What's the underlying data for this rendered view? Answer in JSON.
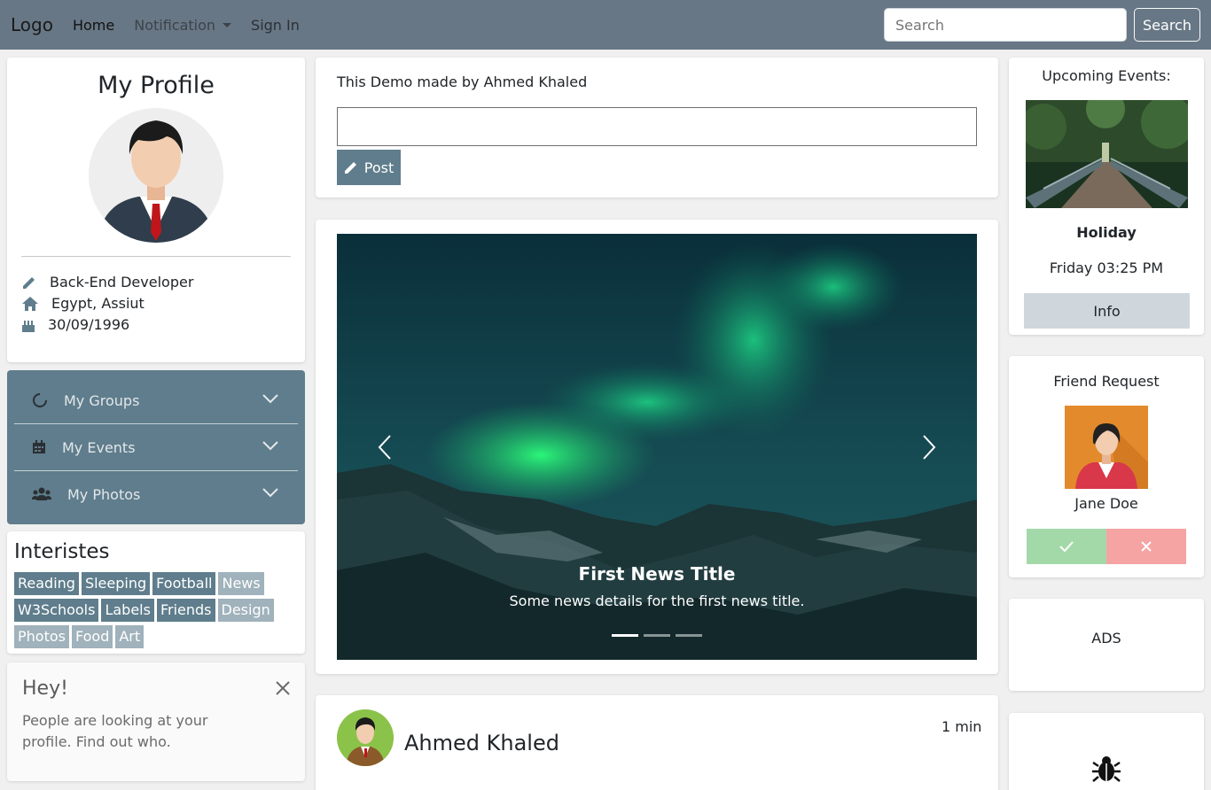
{
  "navbar": {
    "brand": "Logo",
    "links": [
      "Home",
      "Notification",
      "Sign In"
    ],
    "search_placeholder": "Search",
    "search_button": "Search"
  },
  "profile": {
    "title": "My Profile",
    "details": [
      {
        "icon": "pencil-icon",
        "text": "Back-End Developer"
      },
      {
        "icon": "home-icon",
        "text": "Egypt, Assiut"
      },
      {
        "icon": "birthday-cake-icon",
        "text": "30/09/1996"
      }
    ]
  },
  "accordion": {
    "items": [
      {
        "icon": "circle-notch-icon",
        "label": "My Groups"
      },
      {
        "icon": "calendar-icon",
        "label": "My Events"
      },
      {
        "icon": "users-icon",
        "label": "My Photos"
      }
    ]
  },
  "interests": {
    "title": "Interistes",
    "tags": [
      {
        "label": "Reading",
        "style": "dark"
      },
      {
        "label": "Sleeping",
        "style": "dark"
      },
      {
        "label": "Football",
        "style": "dark"
      },
      {
        "label": "News",
        "style": "light"
      },
      {
        "label": "W3Schools",
        "style": "dark"
      },
      {
        "label": "Labels",
        "style": "dark"
      },
      {
        "label": "Friends",
        "style": "dark"
      },
      {
        "label": "Design",
        "style": "light"
      },
      {
        "label": "Photos",
        "style": "light"
      },
      {
        "label": "Food",
        "style": "light"
      },
      {
        "label": "Art",
        "style": "light"
      }
    ]
  },
  "alert": {
    "title": "Hey!",
    "text": "People are looking at your profile. Find out who."
  },
  "post_box": {
    "intro": "This Demo made by Ahmed Khaled",
    "input_value": "",
    "button": "Post"
  },
  "carousel": {
    "caption_title": "First News Title",
    "caption_text": "Some news details for the first news title.",
    "slide_count": 3,
    "active_slide": 1
  },
  "post": {
    "author": "Ahmed Khaled",
    "time": "1 min"
  },
  "events": {
    "title": "Upcoming Events:",
    "name": "Holiday",
    "when": "Friday 03:25 PM",
    "button": "Info"
  },
  "friend_request": {
    "title": "Friend Request",
    "name": "Jane Doe"
  },
  "ads": {
    "label": "ADS"
  },
  "colors": {
    "navbar": "#687785",
    "accent": "#5f7d8c",
    "accept": "#a3d9a9",
    "reject": "#f5a3a3"
  }
}
